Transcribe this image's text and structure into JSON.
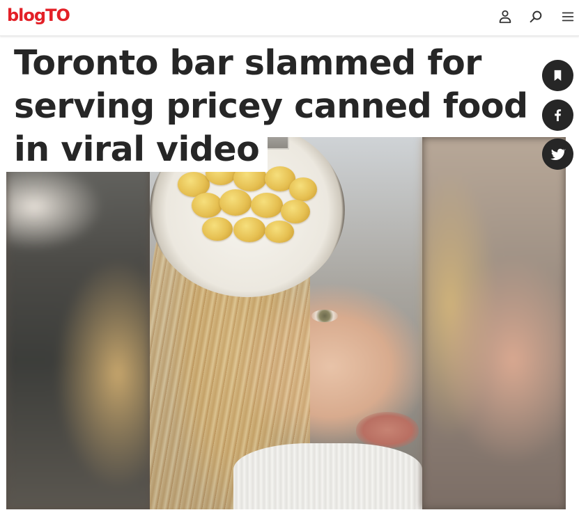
{
  "site": {
    "logo_text": "blogTO",
    "brand_color": "#e32027"
  },
  "header": {
    "icons": [
      "user-icon",
      "search-icon",
      "menu-icon"
    ]
  },
  "article": {
    "headline": "Toronto bar slammed for serving pricey canned food in viral video",
    "headline_color": "#262626"
  },
  "share_rail": {
    "background": "#262626",
    "icons": [
      "bookmark-icon",
      "facebook-icon",
      "twitter-icon"
    ]
  }
}
